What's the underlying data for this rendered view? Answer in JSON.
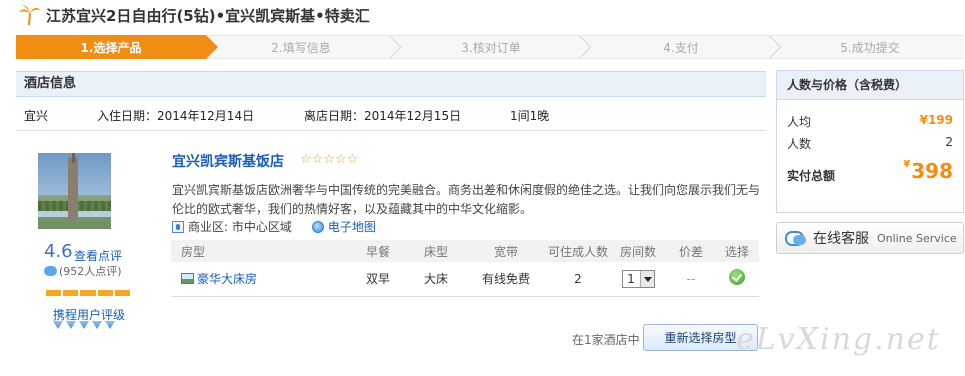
{
  "title": "江苏宜兴2日自由行(5钻)•宜兴凯宾斯基•特卖汇",
  "steps": [
    "1.选择产品",
    "2.填写信息",
    "3.核对订单",
    "4.支付",
    "5.成功提交"
  ],
  "hotel_info": {
    "heading": "酒店信息",
    "city": "宜兴",
    "checkin": "入住日期：2014年12月14日",
    "checkout": "离店日期：2014年12月15日",
    "rooms_nights": "1间1晚"
  },
  "hotel": {
    "score": "4.6",
    "review_link": "查看点评",
    "review_count": "(952人点评)",
    "rating_label": "携程用户评级",
    "rating_level": 5,
    "name": "宜兴凯宾斯基饭店",
    "stars": "☆☆☆☆☆",
    "description": "宜兴凯宾斯基饭店欧洲奢华与中国传统的完美融合。商务出差和休闲度假的绝佳之选。让我们向您展示我们无与伦比的欧式奢华，我们的热情好客，以及蕴藏其中的中华文化缩影。",
    "district": "商业区: 市中心区域",
    "map_link": "电子地图"
  },
  "room_table": {
    "headers": [
      "房型",
      "早餐",
      "床型",
      "宽带",
      "可住成人数",
      "房间数",
      "价差",
      "选择"
    ],
    "rows": [
      {
        "room": "豪华大床房",
        "breakfast": "双早",
        "bed": "大床",
        "internet": "有线免费",
        "adults": "2",
        "rooms": "1",
        "price_diff": "--"
      }
    ]
  },
  "footer": {
    "count_text": "在1家酒店中",
    "reselect_button": "重新选择房型",
    "watermark": "eLvXing.net"
  },
  "price_panel": {
    "heading": "人数与价格（含税费）",
    "per_person_label": "人均",
    "per_person_value": "¥199",
    "people_label": "人数",
    "people_value": "2",
    "total_label": "实付总额",
    "total_currency": "¥",
    "total_value": "398"
  },
  "service": {
    "label_cn": "在线客服",
    "label_en": "Online Service"
  },
  "colors": {
    "accent": "#f08d12",
    "link": "#1a5fb4",
    "panel_header": "#e9f0f8"
  }
}
